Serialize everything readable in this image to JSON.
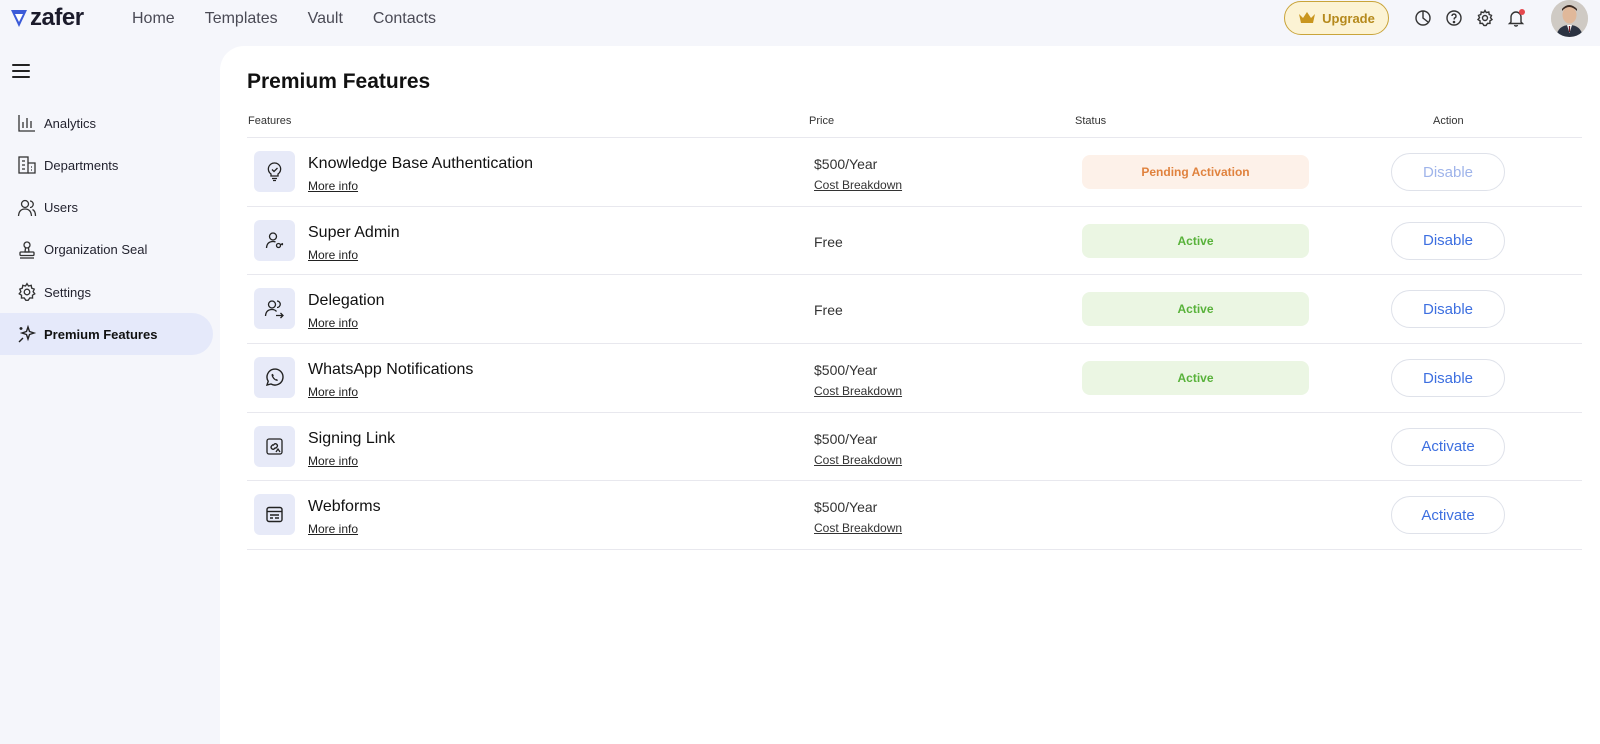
{
  "header": {
    "logo_text": "zafer",
    "nav": [
      "Home",
      "Templates",
      "Vault",
      "Contacts"
    ],
    "upgrade_label": "Upgrade",
    "icons": [
      "pie-chart-icon",
      "help-icon",
      "gear-icon",
      "bell-icon"
    ]
  },
  "sidebar": {
    "items": [
      {
        "label": "Analytics",
        "icon": "bar-chart-icon"
      },
      {
        "label": "Departments",
        "icon": "building-icon"
      },
      {
        "label": "Users",
        "icon": "users-icon"
      },
      {
        "label": "Organization Seal",
        "icon": "stamp-icon"
      },
      {
        "label": "Settings",
        "icon": "gear-icon"
      },
      {
        "label": "Premium Features",
        "icon": "sparkles-icon",
        "active": true
      }
    ]
  },
  "main": {
    "title": "Premium Features",
    "columns": [
      "Features",
      "Price",
      "Status",
      "Action"
    ],
    "rows": [
      {
        "icon": "lightbulb-icon",
        "name": "Knowledge Base Authentication",
        "more": "More info",
        "price": "$500/Year",
        "cost": "Cost Breakdown",
        "status": "Pending Activation",
        "action": "Disable"
      },
      {
        "icon": "user-key-icon",
        "name": "Super Admin",
        "more": "More info",
        "price": "Free",
        "cost": "",
        "status": "Active",
        "action": "Disable"
      },
      {
        "icon": "user-transfer-icon",
        "name": "Delegation",
        "more": "More info",
        "price": "Free",
        "cost": "",
        "status": "Active",
        "action": "Disable"
      },
      {
        "icon": "whatsapp-icon",
        "name": "WhatsApp Notifications",
        "more": "More info",
        "price": "$500/Year",
        "cost": "Cost Breakdown",
        "status": "Active",
        "action": "Disable"
      },
      {
        "icon": "signing-link-icon",
        "name": "Signing Link",
        "more": "More info",
        "price": "$500/Year",
        "cost": "Cost Breakdown",
        "status": "",
        "action": "Activate"
      },
      {
        "icon": "webform-icon",
        "name": "Webforms",
        "more": "More info",
        "price": "$500/Year",
        "cost": "Cost Breakdown",
        "status": "",
        "action": "Activate"
      }
    ]
  },
  "colors": {
    "accent": "#3d6fe0",
    "pending_bg": "#fdf1e9",
    "pending_text": "#e0823e",
    "active_bg": "#ebf6e3",
    "active_text": "#58b23a",
    "upgrade_bg": "#fcf3d4",
    "upgrade_text": "#b5891c"
  }
}
